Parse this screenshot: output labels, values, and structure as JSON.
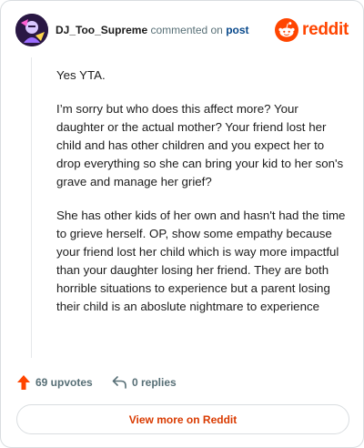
{
  "header": {
    "username": "DJ_Too_Supreme",
    "verb": " commented on ",
    "post_link": "post",
    "brand_name": "reddit",
    "brand_color": "#ff4500",
    "avatar_icon": "user-avatar",
    "brand_icon": "reddit-snoo-icon"
  },
  "comment": {
    "paragraphs": [
      "Yes YTA.",
      "I’m sorry but who does this affect more? Your daughter or the actual mother? Your friend lost her child and has other children and you expect her to drop everything so she can bring your kid to her son's grave and manage her grief?",
      "She has other kids of her own and hasn't had the time to grieve herself. OP, show some empathy because your friend lost her child which is way more impactful than your daughter losing her friend. They are both horrible situations to experience but a parent losing their child is an aboslute nightmare to experience"
    ]
  },
  "footer": {
    "upvotes_label": "69 upvotes",
    "replies_label": "0 replies",
    "upvote_color": "#ff4500"
  },
  "cta": {
    "label": "View more on Reddit",
    "color": "#d93a00"
  }
}
